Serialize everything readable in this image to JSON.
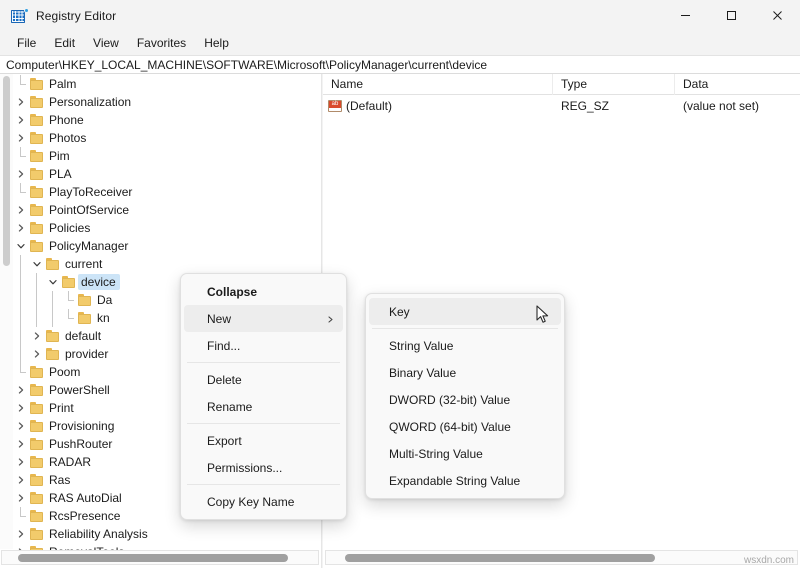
{
  "window": {
    "title": "Registry Editor",
    "icon": "registry-editor-icon",
    "controls": {
      "minimize": "minimize-icon",
      "maximize": "maximize-icon",
      "close": "close-icon"
    }
  },
  "menubar": {
    "items": [
      {
        "label": "File"
      },
      {
        "label": "Edit"
      },
      {
        "label": "View"
      },
      {
        "label": "Favorites"
      },
      {
        "label": "Help"
      }
    ]
  },
  "address": {
    "path": "Computer\\HKEY_LOCAL_MACHINE\\SOFTWARE\\Microsoft\\PolicyManager\\current\\device"
  },
  "tree": {
    "items": [
      {
        "label": "Palm",
        "depth": 1,
        "marker": "elbow",
        "selected": false
      },
      {
        "label": "Personalization",
        "depth": 1,
        "marker": "collapsed",
        "selected": false
      },
      {
        "label": "Phone",
        "depth": 1,
        "marker": "collapsed",
        "selected": false
      },
      {
        "label": "Photos",
        "depth": 1,
        "marker": "collapsed",
        "selected": false
      },
      {
        "label": "Pim",
        "depth": 1,
        "marker": "elbow",
        "selected": false
      },
      {
        "label": "PLA",
        "depth": 1,
        "marker": "collapsed",
        "selected": false
      },
      {
        "label": "PlayToReceiver",
        "depth": 1,
        "marker": "elbow",
        "selected": false
      },
      {
        "label": "PointOfService",
        "depth": 1,
        "marker": "collapsed",
        "selected": false
      },
      {
        "label": "Policies",
        "depth": 1,
        "marker": "collapsed",
        "selected": false
      },
      {
        "label": "PolicyManager",
        "depth": 1,
        "marker": "expanded",
        "selected": false
      },
      {
        "label": "current",
        "depth": 2,
        "marker": "expanded",
        "selected": false
      },
      {
        "label": "device",
        "depth": 3,
        "marker": "expanded",
        "selected": true
      },
      {
        "label": "Da",
        "depth": 4,
        "marker": "elbow",
        "selected": false
      },
      {
        "label": "kn",
        "depth": 4,
        "marker": "elbow",
        "selected": false
      },
      {
        "label": "default",
        "depth": 2,
        "marker": "collapsed",
        "selected": false
      },
      {
        "label": "provider",
        "depth": 2,
        "marker": "collapsed",
        "selected": false
      },
      {
        "label": "Poom",
        "depth": 1,
        "marker": "elbow",
        "selected": false
      },
      {
        "label": "PowerShell",
        "depth": 1,
        "marker": "collapsed",
        "selected": false
      },
      {
        "label": "Print",
        "depth": 1,
        "marker": "collapsed",
        "selected": false
      },
      {
        "label": "Provisioning",
        "depth": 1,
        "marker": "collapsed",
        "selected": false
      },
      {
        "label": "PushRouter",
        "depth": 1,
        "marker": "collapsed",
        "selected": false
      },
      {
        "label": "RADAR",
        "depth": 1,
        "marker": "collapsed",
        "selected": false
      },
      {
        "label": "Ras",
        "depth": 1,
        "marker": "collapsed",
        "selected": false
      },
      {
        "label": "RAS AutoDial",
        "depth": 1,
        "marker": "collapsed",
        "selected": false
      },
      {
        "label": "RcsPresence",
        "depth": 1,
        "marker": "elbow",
        "selected": false
      },
      {
        "label": "Reliability Analysis",
        "depth": 1,
        "marker": "collapsed",
        "selected": false
      },
      {
        "label": "RemovalTools",
        "depth": 1,
        "marker": "collapsed",
        "selected": false
      }
    ]
  },
  "values": {
    "columns": [
      "Name",
      "Type",
      "Data"
    ],
    "rows": [
      {
        "name": "(Default)",
        "type": "REG_SZ",
        "data": "(value not set)",
        "icon": "string-value-icon",
        "icon_text": "ab"
      }
    ]
  },
  "context_menu": {
    "items": [
      {
        "label": "Collapse",
        "bold": true,
        "highlighted": false,
        "submenu": false,
        "separator_after": false
      },
      {
        "label": "New",
        "bold": false,
        "highlighted": true,
        "submenu": true,
        "separator_after": false
      },
      {
        "label": "Find...",
        "bold": false,
        "highlighted": false,
        "submenu": false,
        "separator_after": true
      },
      {
        "label": "Delete",
        "bold": false,
        "highlighted": false,
        "submenu": false,
        "separator_after": false
      },
      {
        "label": "Rename",
        "bold": false,
        "highlighted": false,
        "submenu": false,
        "separator_after": true
      },
      {
        "label": "Export",
        "bold": false,
        "highlighted": false,
        "submenu": false,
        "separator_after": false
      },
      {
        "label": "Permissions...",
        "bold": false,
        "highlighted": false,
        "submenu": false,
        "separator_after": true
      },
      {
        "label": "Copy Key Name",
        "bold": false,
        "highlighted": false,
        "submenu": false,
        "separator_after": false
      }
    ]
  },
  "submenu": {
    "items": [
      {
        "label": "Key",
        "highlighted": true,
        "separator_after": true
      },
      {
        "label": "String Value",
        "highlighted": false,
        "separator_after": false
      },
      {
        "label": "Binary Value",
        "highlighted": false,
        "separator_after": false
      },
      {
        "label": "DWORD (32-bit) Value",
        "highlighted": false,
        "separator_after": false
      },
      {
        "label": "QWORD (64-bit) Value",
        "highlighted": false,
        "separator_after": false
      },
      {
        "label": "Multi-String Value",
        "highlighted": false,
        "separator_after": false
      },
      {
        "label": "Expandable String Value",
        "highlighted": false,
        "separator_after": false
      }
    ]
  },
  "watermark": {
    "text": "wsxdn.com"
  },
  "colors": {
    "selection": "#cce4f7",
    "menu_highlight": "#ededed",
    "folder": "#f2cb6b",
    "accent": "#1a6fc4",
    "string_icon": "#d94a2b"
  }
}
